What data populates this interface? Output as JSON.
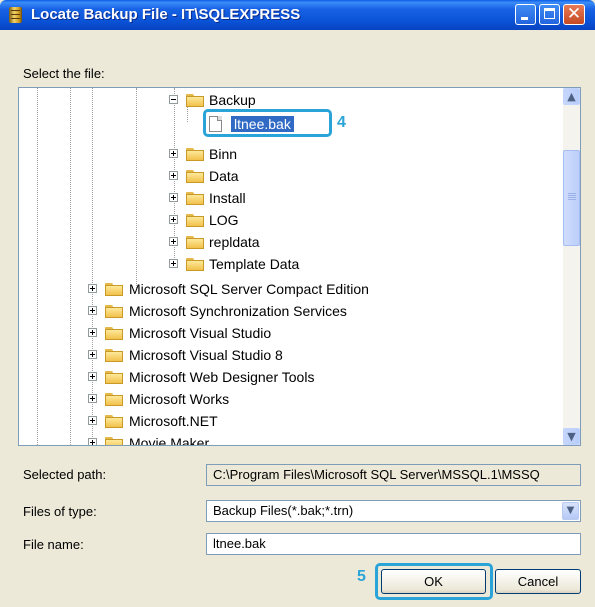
{
  "window": {
    "title": "Locate Backup File - IT\\SQLEXPRESS"
  },
  "select_file_label": "Select the file:",
  "tree": {
    "nodes": [
      {
        "label": "Backup",
        "expanded": true
      },
      {
        "label": "ltnee.bak",
        "selected": true
      },
      {
        "label": "Binn"
      },
      {
        "label": "Data"
      },
      {
        "label": "Install"
      },
      {
        "label": "LOG"
      },
      {
        "label": "repldata"
      },
      {
        "label": "Template Data"
      },
      {
        "label": "Microsoft SQL Server Compact Edition"
      },
      {
        "label": "Microsoft Synchronization Services"
      },
      {
        "label": "Microsoft Visual Studio"
      },
      {
        "label": "Microsoft Visual Studio 8"
      },
      {
        "label": "Microsoft Web Designer Tools"
      },
      {
        "label": "Microsoft Works"
      },
      {
        "label": "Microsoft.NET"
      },
      {
        "label": "Movie Maker"
      }
    ]
  },
  "callouts": {
    "file": "4",
    "ok": "5"
  },
  "selected_path": {
    "label": "Selected path:",
    "value": "C:\\Program Files\\Microsoft SQL Server\\MSSQL.1\\MSSQ"
  },
  "files_of_type": {
    "label": "Files of type:",
    "value": "Backup Files(*.bak;*.trn)"
  },
  "file_name": {
    "label": "File name:",
    "value": "ltnee.bak"
  },
  "buttons": {
    "ok": "OK",
    "cancel": "Cancel"
  },
  "colors": {
    "accent": "#2aa4d8",
    "selection": "#316ac5",
    "titlebar": "#0a53d7"
  }
}
